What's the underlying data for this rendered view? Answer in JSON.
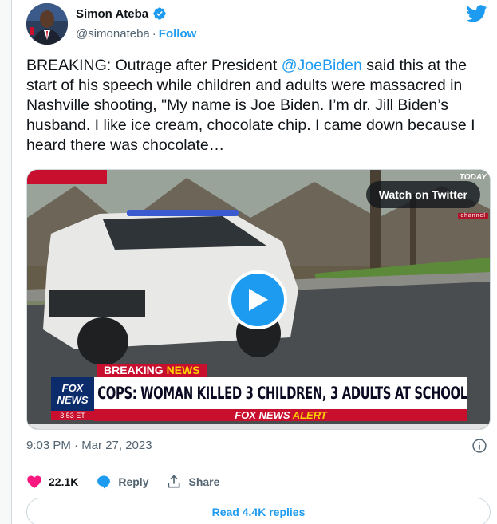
{
  "author": {
    "display_name": "Simon Ateba",
    "handle": "@simonateba",
    "separator": "·",
    "follow_label": "Follow"
  },
  "tweet": {
    "text_before_mention": "BREAKING: Outrage after President ",
    "mention": "@JoeBiden",
    "text_after_mention": " said this at the start of his speech while children and adults were massacred in Nashville shooting, \"My name is Joe Biden. I’m dr. Jill Biden’s husband. I like ice cream, chocolate chip. I came down because I heard there was chocolate…"
  },
  "media": {
    "watch_label": "Watch on Twitter",
    "channel_logo_top": "TODAY",
    "channel_logo_bottom": "channel",
    "breaking_word": "BREAKING",
    "news_word": "NEWS",
    "headline": "COPS: WOMAN KILLED 3 CHILDREN, 3 ADULTS AT SCHOOL",
    "alert_brand": "FOX NEWS",
    "alert_word": "ALERT",
    "fox_line1": "FOX",
    "fox_line2": "NEWS",
    "clock": "3:53 ET"
  },
  "meta": {
    "timestamp": "9:03 PM · Mar 27, 2023"
  },
  "actions": {
    "likes": "22.1K",
    "reply_label": "Reply",
    "share_label": "Share"
  },
  "replies": {
    "read_label": "Read 4.4K replies"
  },
  "colors": {
    "accent": "#1d9bf0",
    "like": "#f91880",
    "fox_red": "#c8102e",
    "fox_navy": "#0b2b6b"
  },
  "icons": [
    "verified-icon",
    "twitter-bird-icon",
    "play-icon",
    "info-icon",
    "heart-icon",
    "reply-icon",
    "share-icon"
  ]
}
